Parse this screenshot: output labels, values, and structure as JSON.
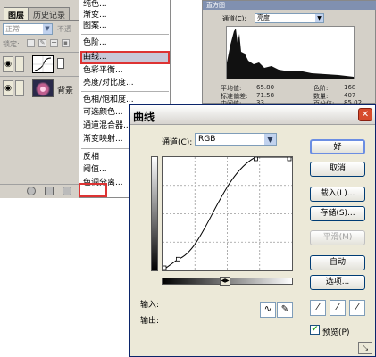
{
  "layers_panel": {
    "tabs": [
      "图层",
      "历史记录"
    ],
    "blend_mode": "正常",
    "opacity_label": "不透",
    "lock_label": "锁定:",
    "layers": [
      {
        "name": "",
        "type": "curves-adjustment"
      },
      {
        "name": "背景",
        "type": "image"
      }
    ]
  },
  "menu": {
    "items_top": [
      "纯色...",
      "渐变...",
      "图案..."
    ],
    "items_group2": [
      "色阶...",
      "曲线...",
      "色彩平衡...",
      "亮度/对比度..."
    ],
    "items_group3": [
      "色相/饱和度...",
      "可选颜色...",
      "通道混合器...",
      "渐变映射..."
    ],
    "items_group4": [
      "反相",
      "阈值...",
      "色调分离..."
    ],
    "highlighted": "曲线..."
  },
  "histogram": {
    "title": "直方图",
    "channel_label": "通道(C):",
    "channel_value": "亮度",
    "stats": {
      "mean_label": "平均值:",
      "mean": "65.80",
      "std_label": "标准偏差:",
      "std": "71.58",
      "median_label": "中间值:",
      "median": "33",
      "level_label": "色阶:",
      "level": "168",
      "count_label": "数量:",
      "count": "407",
      "percent_label": "百分位:",
      "percent": "85.02"
    }
  },
  "curves_dialog": {
    "title": "曲线",
    "channel_label": "通道(C):",
    "channel_value": "RGB",
    "input_label": "输入:",
    "output_label": "输出:",
    "buttons": {
      "ok": "好",
      "cancel": "取消",
      "load": "载入(L)...",
      "save": "存储(S)...",
      "smooth": "平滑(M)",
      "auto": "自动",
      "options": "选项..."
    },
    "preview_label": "预览(P)",
    "preview_checked": true,
    "curve_points": [
      [
        0,
        0
      ],
      [
        0.12,
        0.1
      ],
      [
        0.72,
        1.0
      ],
      [
        1.0,
        1.0
      ]
    ]
  },
  "colors": {
    "highlight_red": "#dd3333",
    "dialog_border": "#0a246a",
    "button_border": "#003c74"
  }
}
